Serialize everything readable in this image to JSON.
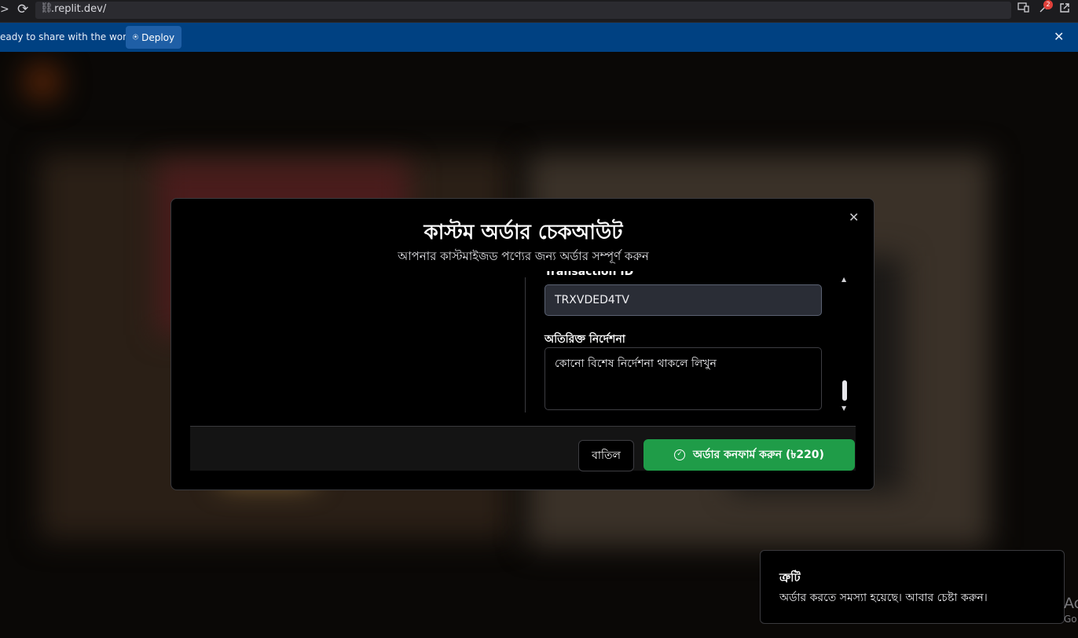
{
  "browser": {
    "forward_glyph": ">",
    "reload_glyph": "⟳",
    "link_glyph": "⛓",
    "url": ".replit.dev/",
    "extension_badge": "2"
  },
  "banner": {
    "text": "eady to share with the world?",
    "deploy_label": "Deploy",
    "deploy_glyph": "⍟",
    "close_glyph": "✕"
  },
  "modal": {
    "close_glyph": "✕",
    "title": "কাস্টম অর্ডার চেকআউট",
    "subtitle": "আপনার কাস্টমাইজড পণ্যের জন্য অর্ডার সম্পূর্ণ করুন",
    "transaction_label": "Transaction ID",
    "transaction_value": "TRXVDED4TV",
    "notes_label": "অতিরিক্ত নির্দেশনা",
    "notes_placeholder": "কোনো বিশেষ নির্দেশনা থাকলে লিখুন",
    "scroll_up_glyph": "▲",
    "scroll_down_glyph": "▼",
    "cancel_label": "বাতিল",
    "confirm_label": "অর্ডার কনফার্ম করুন (৳220)",
    "check_glyph": "✓"
  },
  "toast": {
    "title": "ত্রুটি",
    "message": "অর্ডার করতে সমস্যা হয়েছে। আবার চেষ্টা করুন।"
  },
  "os_hint": {
    "line1": "Ac",
    "line2": "Go"
  },
  "colors": {
    "banner_bg": "#004182",
    "confirm_bg": "#1f9c48",
    "input_bg": "#2a2d36"
  }
}
